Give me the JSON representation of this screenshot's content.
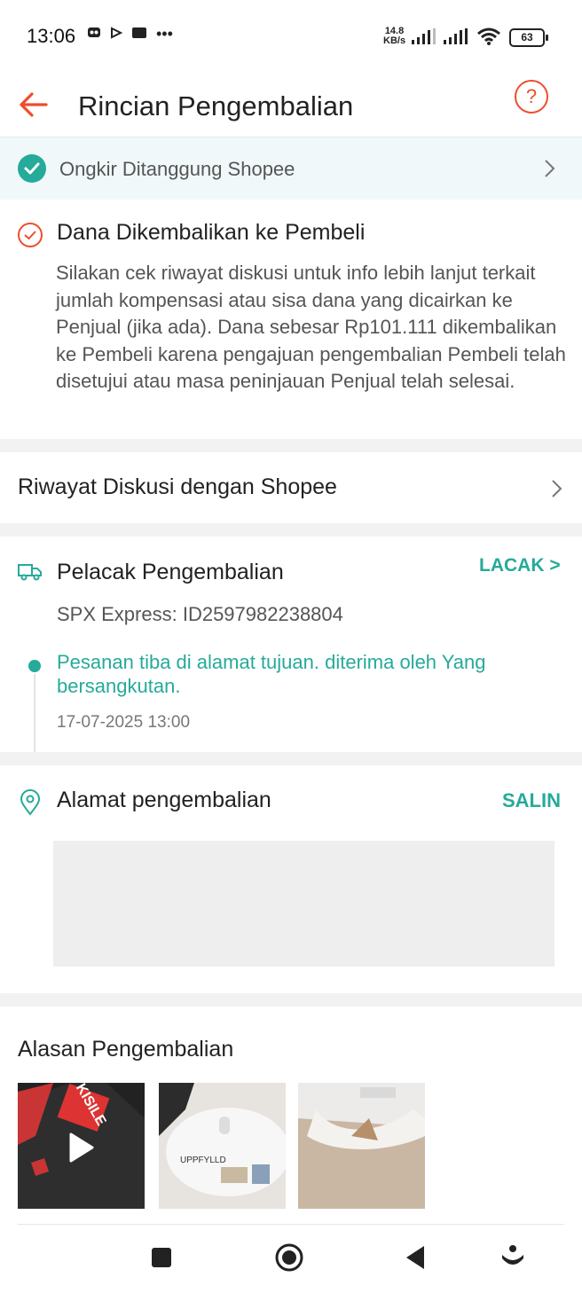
{
  "status_bar": {
    "time": "13:06",
    "net_speed_value": "14.8",
    "net_speed_unit": "KB/s",
    "battery": "63",
    "more": "•••"
  },
  "header": {
    "title": "Rincian Pengembalian",
    "help": "?"
  },
  "banner": {
    "text": "Ongkir Ditanggung Shopee"
  },
  "refund_status": {
    "title": "Dana Dikembalikan ke Pembeli",
    "body": "Silakan cek riwayat diskusi untuk info lebih lanjut terkait jumlah kompensasi atau sisa dana yang dicairkan ke Penjual (jika ada). Dana sebesar Rp101.111 dikembalikan ke Pembeli karena pengajuan pengembalian Pembeli telah disetujui atau masa peninjauan Penjual telah selesai."
  },
  "discussion": {
    "label": "Riwayat Diskusi dengan Shopee"
  },
  "tracker": {
    "title": "Pelacak Pengembalian",
    "action": "LACAK >",
    "courier": "SPX Express: ID2597982238804",
    "event": "Pesanan tiba di alamat tujuan. diterima oleh Yang bersangkutan.",
    "event_time": "17-07-2025 13:00"
  },
  "address": {
    "title": "Alamat pengembalian",
    "action": "SALIN"
  },
  "reason": {
    "title": "Alasan Pengembalian",
    "thumb1_text": "KISILE",
    "thumb2_text": "UPPFYLLD"
  },
  "colors": {
    "accent": "#ee4d2d",
    "teal": "#26aa99"
  }
}
